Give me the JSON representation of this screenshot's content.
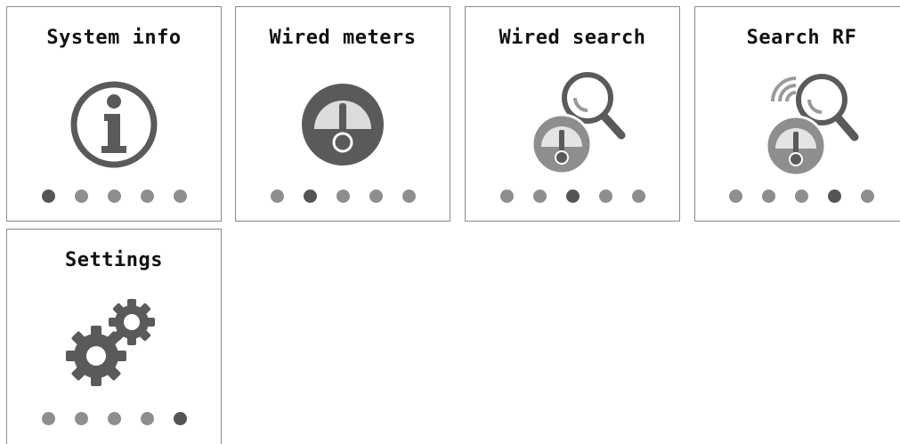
{
  "menu": {
    "tiles": [
      {
        "title": "System info",
        "icon": "info-icon",
        "active_dot": 1,
        "dot_count": 5
      },
      {
        "title": "Wired meters",
        "icon": "gauge-icon",
        "active_dot": 2,
        "dot_count": 5
      },
      {
        "title": "Wired search",
        "icon": "gauge-search-icon",
        "active_dot": 3,
        "dot_count": 5
      },
      {
        "title": "Search RF",
        "icon": "rf-search-icon",
        "active_dot": 4,
        "dot_count": 5
      },
      {
        "title": "Settings",
        "icon": "gears-icon",
        "active_dot": 5,
        "dot_count": 5
      }
    ]
  },
  "colors": {
    "icon_dark": "#5a5a5a",
    "icon_light": "#8e8e8e",
    "dot_inactive": "#8e8e8e",
    "dot_active": "#555555",
    "border": "#8a8a8a"
  }
}
